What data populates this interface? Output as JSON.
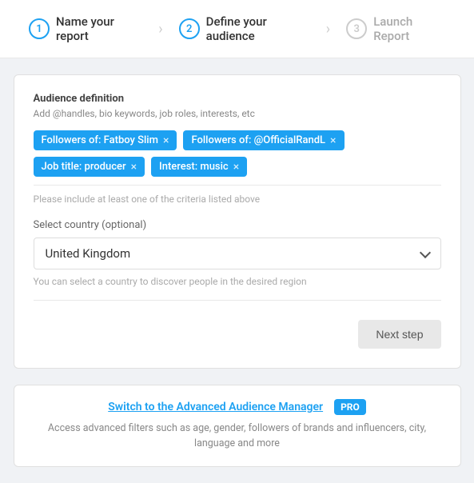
{
  "stepper": {
    "step1": {
      "number": "1",
      "label": "Name your report",
      "state": "active"
    },
    "step2": {
      "number": "2",
      "label": "Define your audience",
      "state": "active"
    },
    "step3": {
      "number": "3",
      "label": "Launch Report",
      "state": "inactive"
    }
  },
  "audience": {
    "title": "Audience definition",
    "subtitle": "Add @handles, bio keywords, job roles, interests, etc",
    "tags": [
      {
        "id": "tag1",
        "label": "Followers of: Fatboy Slim"
      },
      {
        "id": "tag2",
        "label": "Followers of: @OfficialRandL"
      },
      {
        "id": "tag3",
        "label": "Job title: producer"
      },
      {
        "id": "tag4",
        "label": "Interest: music"
      }
    ],
    "hint": "Please include at least one of the criteria listed above",
    "country_label": "Select country (optional)",
    "country_value": "United Kingdom",
    "country_hint": "You can select a country to discover people in the desired region",
    "next_btn": "Next step"
  },
  "advanced": {
    "link_text": "Switch to the Advanced Audience Manager",
    "pro_label": "PRO",
    "description": "Access advanced filters such as age, gender, followers of brands\nand influencers, city, language and more"
  }
}
